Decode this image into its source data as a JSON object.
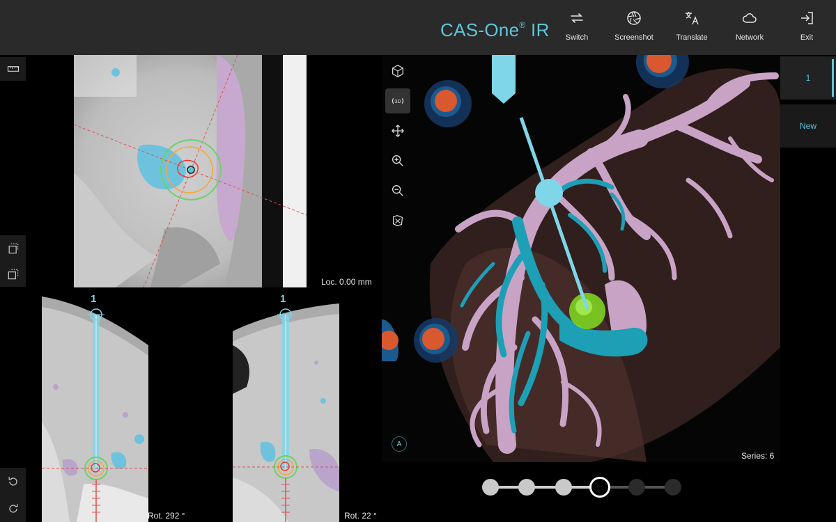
{
  "app": {
    "brand": "CAS-One",
    "brand_sup": "®",
    "brand_suffix": " IR"
  },
  "toolbar": [
    {
      "id": "switch",
      "label": "Switch",
      "icon": "switch-arrows-icon"
    },
    {
      "id": "screenshot",
      "label": "Screenshot",
      "icon": "camera-aperture-icon"
    },
    {
      "id": "translate",
      "label": "Translate",
      "icon": "translate-icon"
    },
    {
      "id": "network",
      "label": "Network",
      "icon": "cloud-icon"
    },
    {
      "id": "exit",
      "label": "Exit",
      "icon": "exit-icon"
    }
  ],
  "left_tools": {
    "top": [
      "ruler-icon"
    ],
    "middle": [
      "select-region-icon",
      "copy-region-icon"
    ],
    "bottom": [
      "rotate-left-icon",
      "rotate-right-icon"
    ]
  },
  "views": {
    "top": {
      "loc_label": "Loc. 0.00 mm"
    },
    "bottom_left": {
      "rot_label": "Rot. 292 °",
      "trajectory_number": "1"
    },
    "bottom_right": {
      "rot_label": "Rot. 22 °",
      "trajectory_number": "1"
    },
    "three_d": {
      "series_label": "Series: 6",
      "corner_label": "A",
      "tools": [
        "cube-view-icon",
        "rotate-3d-icon",
        "pan-icon",
        "zoom-in-icon",
        "zoom-out-icon",
        "reset-view-icon"
      ],
      "tool_3d_text": "3D"
    }
  },
  "right_panel": {
    "tabs": [
      {
        "label": "1",
        "selected": true
      },
      {
        "label": "New",
        "selected": false
      }
    ]
  },
  "stepper": {
    "steps": 6,
    "current": 4
  },
  "colors": {
    "accent": "#5cc6d9",
    "vessel_pink": "#c9a3c6",
    "vessel_cyan": "#1d9fb5",
    "target_green": "#7ed321",
    "marker_red": "#d9582f"
  }
}
